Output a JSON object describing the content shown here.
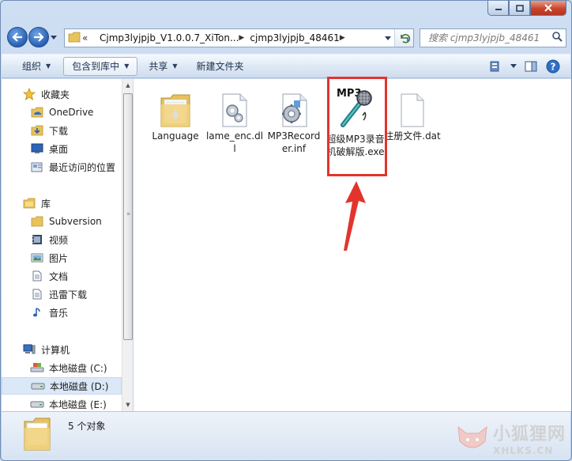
{
  "window": {
    "caption_buttons": [
      "minimize",
      "maximize",
      "close"
    ]
  },
  "address": {
    "overflow": "«",
    "crumbs": [
      "Cjmp3lyjpjb_V1.0.0.7_XiTon...",
      "cjmp3lyjpjb_48461"
    ]
  },
  "search": {
    "placeholder": "搜索 cjmp3lyjpjb_48461"
  },
  "toolbar": {
    "organize": "组织",
    "include_in_library": "包含到库中",
    "share": "共享",
    "new_folder": "新建文件夹"
  },
  "nav": {
    "favorites": {
      "label": "收藏夹",
      "items": [
        "OneDrive",
        "下载",
        "桌面",
        "最近访问的位置"
      ]
    },
    "libraries": {
      "label": "库",
      "items": [
        "Subversion",
        "视频",
        "图片",
        "文档",
        "迅雷下载",
        "音乐"
      ]
    },
    "computer": {
      "label": "计算机",
      "items": [
        "本地磁盘 (C:)",
        "本地磁盘 (D:)",
        "本地磁盘 (E:)"
      ]
    }
  },
  "files": [
    {
      "name": "Language",
      "type": "folder"
    },
    {
      "name": "lame_enc.dll",
      "type": "dll"
    },
    {
      "name": "MP3Recorder.inf",
      "type": "inf"
    },
    {
      "name": "超级MP3录音机破解版.exe",
      "type": "exe",
      "icon_text": "MP3"
    },
    {
      "name": "注册文件.dat",
      "type": "dat"
    }
  ],
  "status": {
    "count": "5 个对象"
  },
  "watermark": {
    "cn": "小狐狸网",
    "en": "XHLKS.CN"
  },
  "colors": {
    "highlight": "#e2342d",
    "selected_nav": "#dbe8f7"
  }
}
